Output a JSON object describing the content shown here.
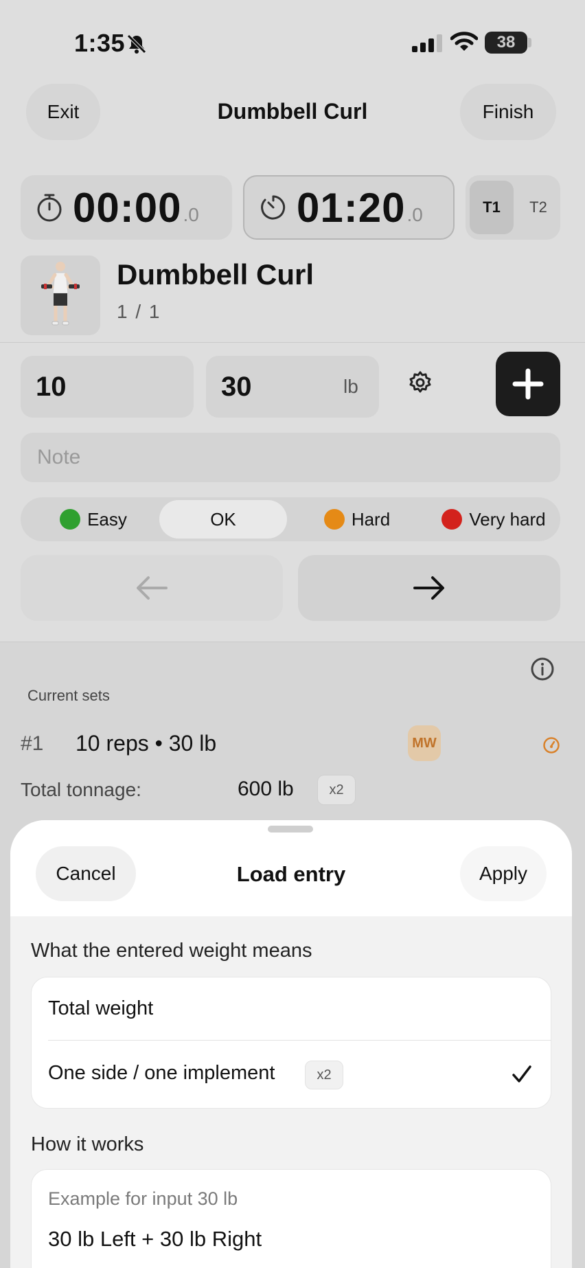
{
  "status_bar": {
    "time": "1:35",
    "battery": "38"
  },
  "nav": {
    "exit_label": "Exit",
    "title": "Dumbbell Curl",
    "finish_label": "Finish"
  },
  "timers": {
    "stopwatch": {
      "value": "00:00",
      "decimal": ".0"
    },
    "rest": {
      "value": "01:20",
      "decimal": ".0"
    },
    "segments": [
      "T1",
      "T2"
    ]
  },
  "exercise": {
    "name": "Dumbbell Curl",
    "progress": "1 / 1"
  },
  "inputs": {
    "reps": "10",
    "weight": "30",
    "unit": "lb",
    "note_placeholder": "Note"
  },
  "difficulty": {
    "options": [
      {
        "label": "Easy",
        "color": "#2fa02f"
      },
      {
        "label": "OK"
      },
      {
        "label": "Hard",
        "color": "#e58a16"
      },
      {
        "label": "Very hard",
        "color": "#d3221c"
      }
    ],
    "selected": "OK"
  },
  "sets": {
    "label": "Current sets",
    "items": [
      {
        "num": "#1",
        "desc": "10 reps • 30 lb",
        "badge": "MW"
      }
    ],
    "tonnage_label": "Total tonnage:",
    "tonnage_value": "600 lb",
    "tonnage_multiplier": "x2"
  },
  "sheet": {
    "cancel_label": "Cancel",
    "title": "Load entry",
    "apply_label": "Apply",
    "meaning_label": "What the entered weight means",
    "options": [
      {
        "label": "Total weight"
      },
      {
        "label": "One side / one implement",
        "badge": "x2",
        "selected": true
      }
    ],
    "how_label": "How it works",
    "example_label": "Example for input 30 lb",
    "example_value": "30 lb Left + 30 lb Right"
  },
  "icons": [
    "bell-slash-icon",
    "signal-icon",
    "wifi-icon",
    "battery-icon",
    "stopwatch-icon",
    "timer-icon",
    "gear-icon",
    "plus-icon",
    "arrow-left-icon",
    "arrow-right-icon",
    "info-icon",
    "gauge-icon",
    "checkmark-icon"
  ]
}
